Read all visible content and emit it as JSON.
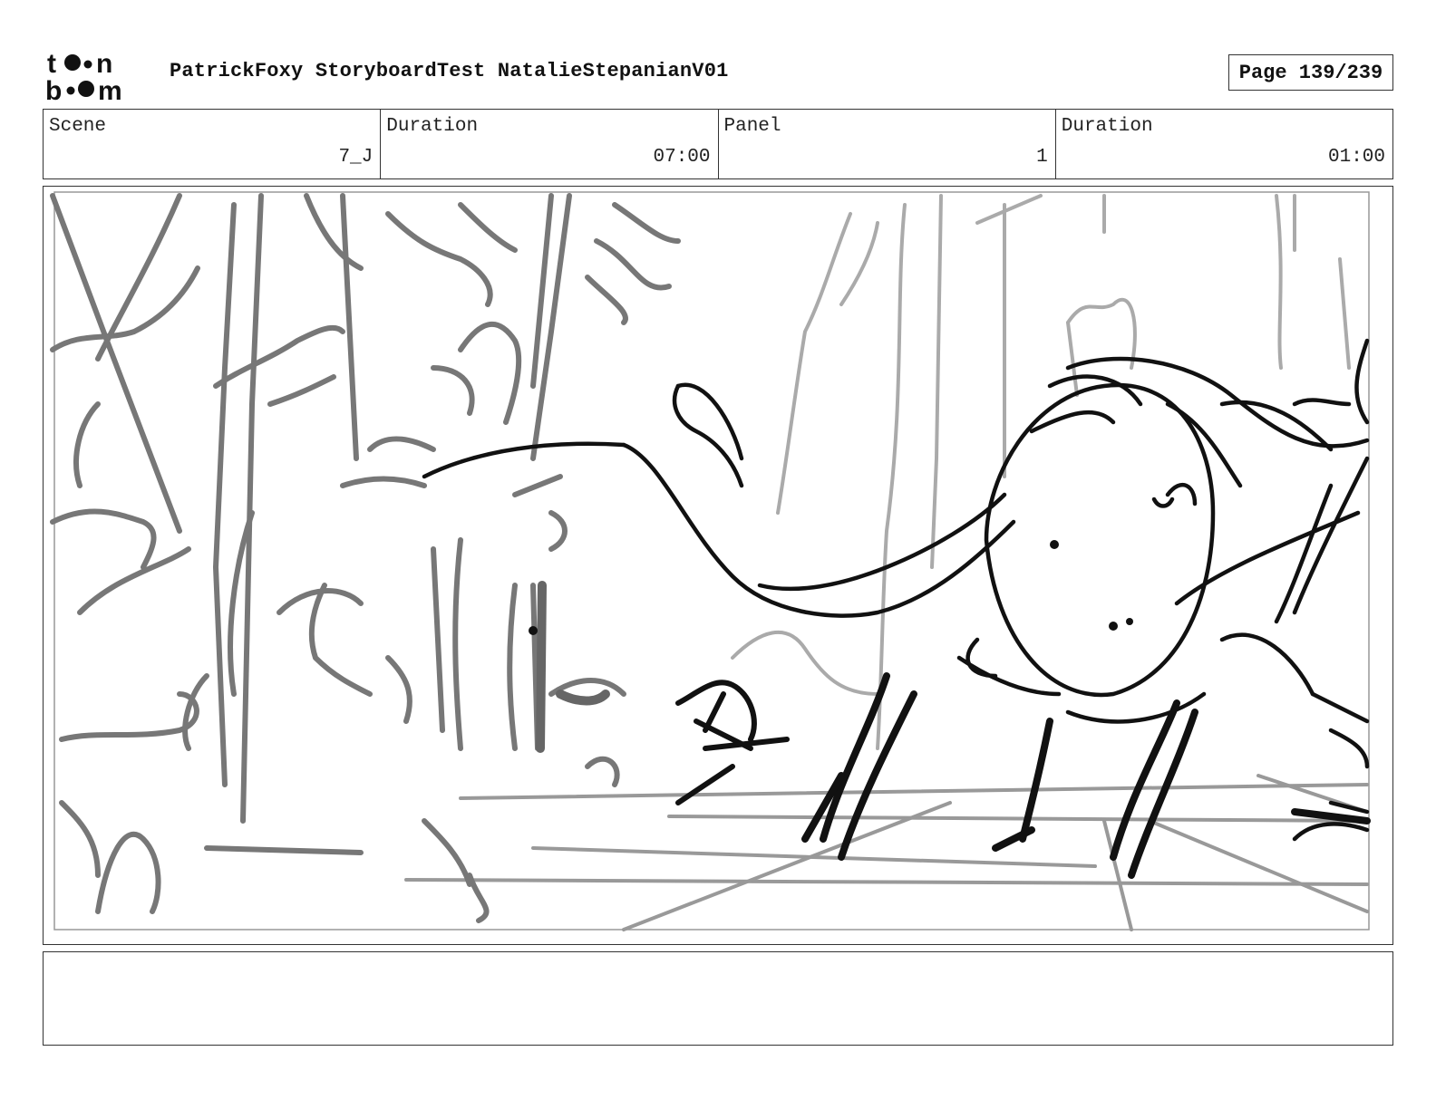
{
  "header": {
    "logo_text": "toon boom",
    "title": "PatrickFoxy StoryboardTest NatalieStepanianV01",
    "page": "Page 139/239"
  },
  "info": {
    "scene_label": "Scene",
    "scene_value": "7_J",
    "scene_duration_label": "Duration",
    "scene_duration_value": "07:00",
    "panel_label": "Panel",
    "panel_value": "1",
    "panel_duration_label": "Duration",
    "panel_duration_value": "01:00"
  },
  "notes": {
    "text": ""
  }
}
